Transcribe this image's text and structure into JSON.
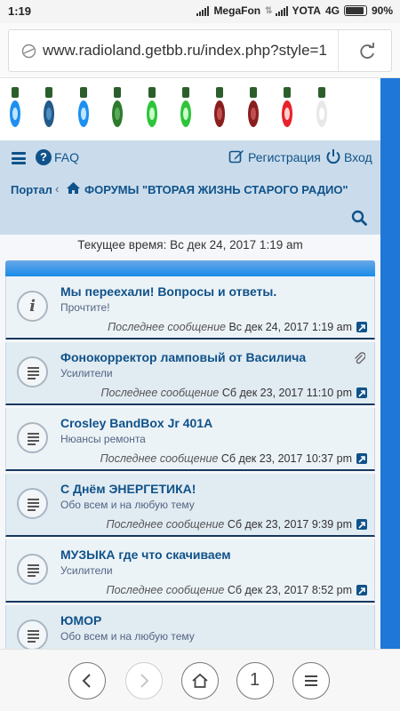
{
  "status_bar": {
    "time": "1:19",
    "carrier1": "MegaFon",
    "carrier2": "YOTA",
    "network": "4G",
    "battery": "90%",
    "battery_level": 0.9
  },
  "browser": {
    "url": "www.radioland.getbb.ru/index.php?style=1",
    "icons": {
      "site": "globe-icon",
      "reload": "reload-icon"
    }
  },
  "header": {
    "faq": "FAQ",
    "register": "Регистрация",
    "login": "Вход",
    "breadcrumb": {
      "portal": "Портал",
      "separator": "‹",
      "forums": "ФОРУМЫ \"ВТОРАЯ ЖИЗНЬ СТАРОГО РАДИО\""
    }
  },
  "current_time": "Текущее время: Вс дек 24, 2017 1:19 am",
  "topics": [
    {
      "title": "Мы переехали! Вопросы и ответы.",
      "forum": "Прочтите!",
      "last_label": "Последнее сообщение",
      "last_date": "Вс дек 24, 2017 1:19 am",
      "icon": "info-icon",
      "attachment": false
    },
    {
      "title": "Фонокорректор ламповый от Василича",
      "forum": "Усилители",
      "last_label": "Последнее сообщение",
      "last_date": "Сб дек 23, 2017 11:10 pm",
      "icon": "topic-icon",
      "attachment": true
    },
    {
      "title": "Crosley BandBox Jr 401A",
      "forum": "Нюансы ремонта",
      "last_label": "Последнее сообщение",
      "last_date": "Сб дек 23, 2017 10:37 pm",
      "icon": "topic-icon",
      "attachment": false
    },
    {
      "title": "С Днём ЭНЕРГЕТИКА!",
      "forum": "Обо всем и на любую тему",
      "last_label": "Последнее сообщение",
      "last_date": "Сб дек 23, 2017 9:39 pm",
      "icon": "topic-icon",
      "attachment": false
    },
    {
      "title": "МУЗЫКА где что скачиваем",
      "forum": "Усилители",
      "last_label": "Последнее сообщение",
      "last_date": "Сб дек 23, 2017 8:52 pm",
      "icon": "topic-icon",
      "attachment": false
    },
    {
      "title": "ЮМОР",
      "forum": "Обо всем и на любую тему",
      "last_label": "",
      "last_date": "",
      "icon": "topic-icon",
      "attachment": false
    }
  ],
  "bottom_nav": {
    "tab_count": "1",
    "icons": [
      "back-icon",
      "forward-icon",
      "home-icon",
      "tabs-counter",
      "menu-icon"
    ]
  },
  "colors": {
    "link": "#105289",
    "header_bg": "#cadceb",
    "topic_border": "#16385e",
    "accent_blue": "#1a8be8"
  }
}
